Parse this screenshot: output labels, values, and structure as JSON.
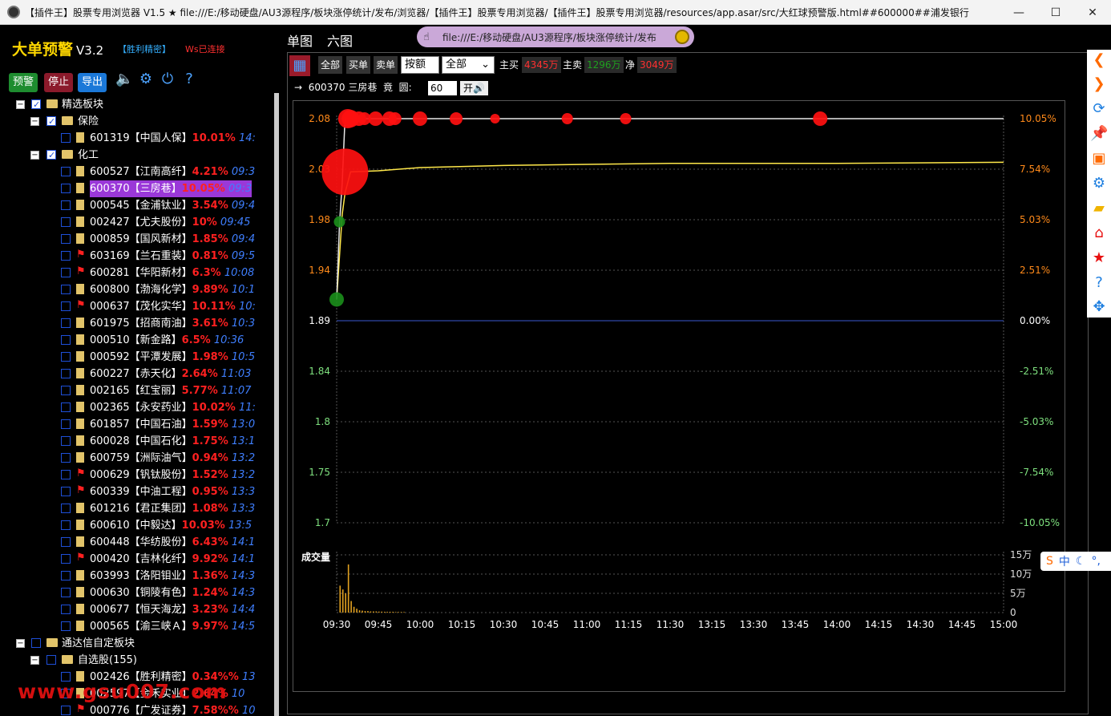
{
  "window": {
    "title": "【插件王】股票专用浏览器 V1.5 ★ file:///E:/移动硬盘/AU3源程序/板块涨停统计/发布/浏览器/【插件王】股票专用浏览器/【插件王】股票专用浏览器/resources/app.asar/src/大红球预警版.html##600000##浦发银行",
    "min": "—",
    "max": "☐",
    "close": "✕"
  },
  "brand": {
    "name": "大单预警",
    "version": "V3.2",
    "tag": "【胜利精密】",
    "ws_status": "Ws已连接"
  },
  "toolbar": {
    "alert": "预警",
    "stop": "停止",
    "export": "导出"
  },
  "tree": {
    "root": "精选板块",
    "groups": [
      {
        "name": "保险",
        "stocks": [
          {
            "code": "601319",
            "name": "【中国人保】",
            "pct": "10.01%",
            "time": "14:"
          }
        ]
      },
      {
        "name": "化工",
        "stocks": [
          {
            "code": "600527",
            "name": "【江南高纤】",
            "pct": "4.21%",
            "time": "09:3"
          },
          {
            "code": "600370",
            "name": "【三房巷】",
            "pct": "10.05%",
            "time": "09:3",
            "selected": true
          },
          {
            "code": "000545",
            "name": "【金浦钛业】",
            "pct": "3.54%",
            "time": "09:4"
          },
          {
            "code": "002427",
            "name": "【尤夫股份】",
            "pct": "10%",
            "time": "09:45"
          },
          {
            "code": "000859",
            "name": "【国风新材】",
            "pct": "1.85%",
            "time": "09:4"
          },
          {
            "code": "603169",
            "name": "【兰石重装】",
            "pct": "0.81%",
            "time": "09:5",
            "flag": true
          },
          {
            "code": "600281",
            "name": "【华阳新材】",
            "pct": "6.3%",
            "time": "10:08",
            "flag": true
          },
          {
            "code": "600800",
            "name": "【渤海化学】",
            "pct": "9.89%",
            "time": "10:1"
          },
          {
            "code": "000637",
            "name": "【茂化实华】",
            "pct": "10.11%",
            "time": "10:",
            "flag": true
          },
          {
            "code": "601975",
            "name": "【招商南油】",
            "pct": "3.61%",
            "time": "10:3"
          },
          {
            "code": "000510",
            "name": "【新金路】",
            "pct": "6.5%",
            "time": "10:36"
          },
          {
            "code": "000592",
            "name": "【平潭发展】",
            "pct": "1.98%",
            "time": "10:5"
          },
          {
            "code": "600227",
            "name": "【赤天化】",
            "pct": "2.64%",
            "time": "11:03"
          },
          {
            "code": "002165",
            "name": "【红宝丽】",
            "pct": "5.77%",
            "time": "11:07"
          },
          {
            "code": "002365",
            "name": "【永安药业】",
            "pct": "10.02%",
            "time": "11:"
          },
          {
            "code": "601857",
            "name": "【中国石油】",
            "pct": "1.59%",
            "time": "13:0"
          },
          {
            "code": "600028",
            "name": "【中国石化】",
            "pct": "1.75%",
            "time": "13:1"
          },
          {
            "code": "600759",
            "name": "【洲际油气】",
            "pct": "0.94%",
            "time": "13:2"
          },
          {
            "code": "000629",
            "name": "【钒钛股份】",
            "pct": "1.52%",
            "time": "13:2",
            "flag": true
          },
          {
            "code": "600339",
            "name": "【中油工程】",
            "pct": "0.95%",
            "time": "13:3",
            "flag": true
          },
          {
            "code": "601216",
            "name": "【君正集团】",
            "pct": "1.08%",
            "time": "13:3"
          },
          {
            "code": "600610",
            "name": "【中毅达】",
            "pct": "10.03%",
            "time": "13:5"
          },
          {
            "code": "600448",
            "name": "【华纺股份】",
            "pct": "6.43%",
            "time": "14:1"
          },
          {
            "code": "000420",
            "name": "【吉林化纤】",
            "pct": "9.92%",
            "time": "14:1",
            "flag": true
          },
          {
            "code": "603993",
            "name": "【洛阳钼业】",
            "pct": "1.36%",
            "time": "14:3"
          },
          {
            "code": "000630",
            "name": "【铜陵有色】",
            "pct": "1.24%",
            "time": "14:3"
          },
          {
            "code": "000677",
            "name": "【恒天海龙】",
            "pct": "3.23%",
            "time": "14:4"
          },
          {
            "code": "000565",
            "name": "【渝三峡Ａ】",
            "pct": "9.97%",
            "time": "14:5"
          }
        ]
      }
    ],
    "root2": "通达信自定板块",
    "group2": "自选股(155)",
    "group2_stocks": [
      {
        "code": "002426",
        "name": "【胜利精密】",
        "pct": "0.34%%",
        "time": "13"
      },
      {
        "code": "002597",
        "name": "【金禾实业】",
        "pct": "2.64%",
        "time": "10"
      },
      {
        "code": "000776",
        "name": "【广发证券】",
        "pct": "7.58%%",
        "time": "10",
        "flag": true
      }
    ]
  },
  "tabs": {
    "single": "单图",
    "six": "六图"
  },
  "urlbar": {
    "cursor_icon": "hand-pointer-icon",
    "url": "file:///E:/移动硬盘/AU3源程序/板块涨停统计/发布"
  },
  "controls": {
    "all": "全部",
    "buy": "买单",
    "sell": "卖单",
    "sort_select": "按额",
    "filter_select": "全部",
    "main_buy_label": "主买",
    "main_buy_value": "4345万",
    "main_sell_label": "主卖",
    "main_sell_value": "1296万",
    "net_label": "净",
    "net_value": "3049万",
    "arrow": "→",
    "stock_line": "600370 三房巷",
    "auction_label": "竟",
    "radius_label": "圆:",
    "radius_value": "60",
    "open_label": "开🔊"
  },
  "chart_data": {
    "type": "line",
    "price_ticks": [
      "2.08",
      "2.03",
      "1.98",
      "1.94",
      "1.89",
      "1.84",
      "1.8",
      "1.75",
      "1.7"
    ],
    "pct_ticks": [
      "10.05%",
      "7.54%",
      "5.03%",
      "2.51%",
      "0.00%",
      "-2.51%",
      "-5.03%",
      "-7.54%",
      "-10.05%"
    ],
    "ylim": [
      1.7,
      2.08
    ],
    "prev_close": 1.89,
    "time_ticks": [
      "09:30",
      "09:45",
      "10:00",
      "10:15",
      "10:30",
      "10:45",
      "11:00",
      "11:15",
      "11:30",
      "13:15",
      "13:30",
      "13:45",
      "14:00",
      "14:15",
      "14:30",
      "14:45",
      "15:00"
    ],
    "price_series": [
      [
        0,
        1.91
      ],
      [
        1,
        1.98
      ],
      [
        2,
        2.02
      ],
      [
        3,
        2.08
      ],
      [
        240,
        2.08
      ]
    ],
    "avg_series": [
      [
        0,
        1.91
      ],
      [
        1,
        1.95
      ],
      [
        2,
        1.99
      ],
      [
        3,
        2.01
      ],
      [
        5,
        2.03
      ],
      [
        15,
        2.031
      ],
      [
        30,
        2.034
      ],
      [
        60,
        2.036
      ],
      [
        90,
        2.037
      ],
      [
        120,
        2.038
      ],
      [
        180,
        2.038
      ],
      [
        240,
        2.039
      ]
    ],
    "bubbles": [
      {
        "t": 3,
        "price": 2.03,
        "r": 29,
        "color": "#ff1010"
      },
      {
        "t": 4,
        "price": 2.08,
        "r": 12,
        "color": "#ff1010"
      },
      {
        "t": 5,
        "price": 2.08,
        "r": 11,
        "color": "#ff1010"
      },
      {
        "t": 8,
        "price": 2.08,
        "r": 9,
        "color": "#ff1010"
      },
      {
        "t": 10,
        "price": 2.08,
        "r": 8,
        "color": "#ff1010"
      },
      {
        "t": 14,
        "price": 2.08,
        "r": 9,
        "color": "#ff1010"
      },
      {
        "t": 19,
        "price": 2.08,
        "r": 9,
        "color": "#ff1010"
      },
      {
        "t": 21,
        "price": 2.08,
        "r": 8,
        "color": "#ff1010"
      },
      {
        "t": 30,
        "price": 2.08,
        "r": 9,
        "color": "#ff1010"
      },
      {
        "t": 43,
        "price": 2.08,
        "r": 8,
        "color": "#ff1010"
      },
      {
        "t": 57,
        "price": 2.08,
        "r": 6,
        "color": "#ff1010"
      },
      {
        "t": 83,
        "price": 2.08,
        "r": 7,
        "color": "#ff1010"
      },
      {
        "t": 104,
        "price": 2.08,
        "r": 7,
        "color": "#ff1010"
      },
      {
        "t": 174,
        "price": 2.08,
        "r": 9,
        "color": "#ff1010"
      },
      {
        "t": 0,
        "price": 1.91,
        "r": 9,
        "color": "#1a8c1a"
      },
      {
        "t": 1,
        "price": 1.983,
        "r": 7,
        "color": "#1a8c1a"
      }
    ],
    "volume_label": "成交量",
    "volume_ticks": [
      "15万",
      "10万",
      "5万",
      "0"
    ],
    "volume_max": 150000,
    "volume": [
      0,
      70000,
      60000,
      50000,
      125000,
      30000,
      15000,
      10000,
      6000,
      5000,
      4000,
      4000,
      3000,
      3000,
      3000,
      2500,
      2500,
      2000,
      2000,
      2000,
      2000,
      1500,
      1500,
      1500,
      1500
    ]
  },
  "ime": {
    "logo": "sogou-icon",
    "cn": "中",
    "moon": "moon-icon",
    "more": "°,"
  },
  "watermark": "www.gsu007.com"
}
